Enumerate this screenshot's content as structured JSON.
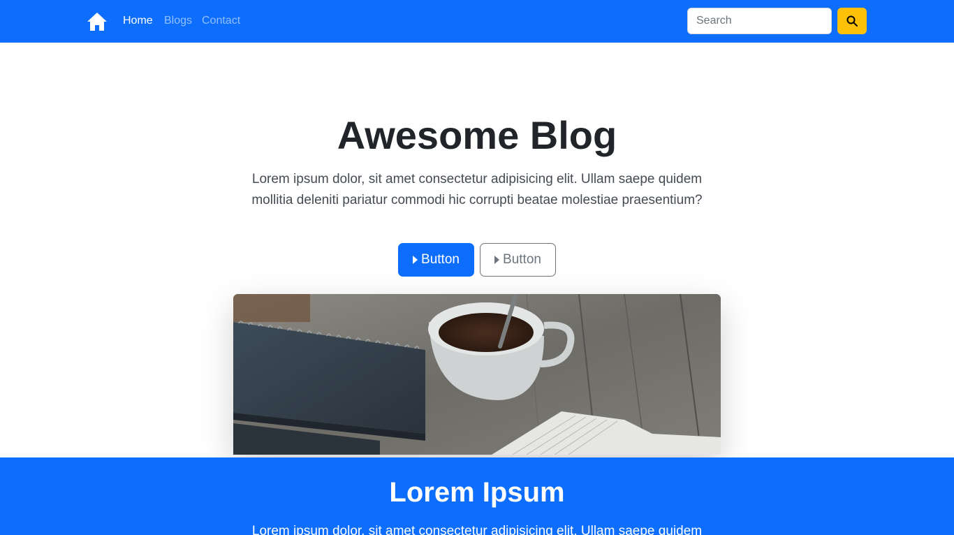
{
  "colors": {
    "primary": "#0d6efd",
    "warning": "#ffc107",
    "text": "#212529",
    "muted": "#6c757d"
  },
  "navbar": {
    "brand_icon": "home-icon",
    "links": [
      {
        "label": "Home",
        "active": true
      },
      {
        "label": "Blogs",
        "active": false
      },
      {
        "label": "Contact",
        "active": false
      }
    ],
    "search": {
      "placeholder": "Search",
      "value": "",
      "button_icon": "search-icon"
    }
  },
  "hero": {
    "title": "Awesome Blog",
    "text": "Lorem ipsum dolor, sit amet consectetur adipisicing elit. Ullam saepe quidem mollitia deleniti pariatur commodi hic corrupti beatae molestiae praesentium?",
    "buttons": [
      {
        "label": "Button",
        "icon": "caret-right-icon",
        "style": "primary"
      },
      {
        "label": "Button",
        "icon": "caret-right-icon",
        "style": "outline-secondary"
      }
    ]
  },
  "section": {
    "title": "Lorem Ipsum",
    "text": "Lorem ipsum dolor, sit amet consectetur adipisicing elit. Ullam saepe quidem"
  }
}
